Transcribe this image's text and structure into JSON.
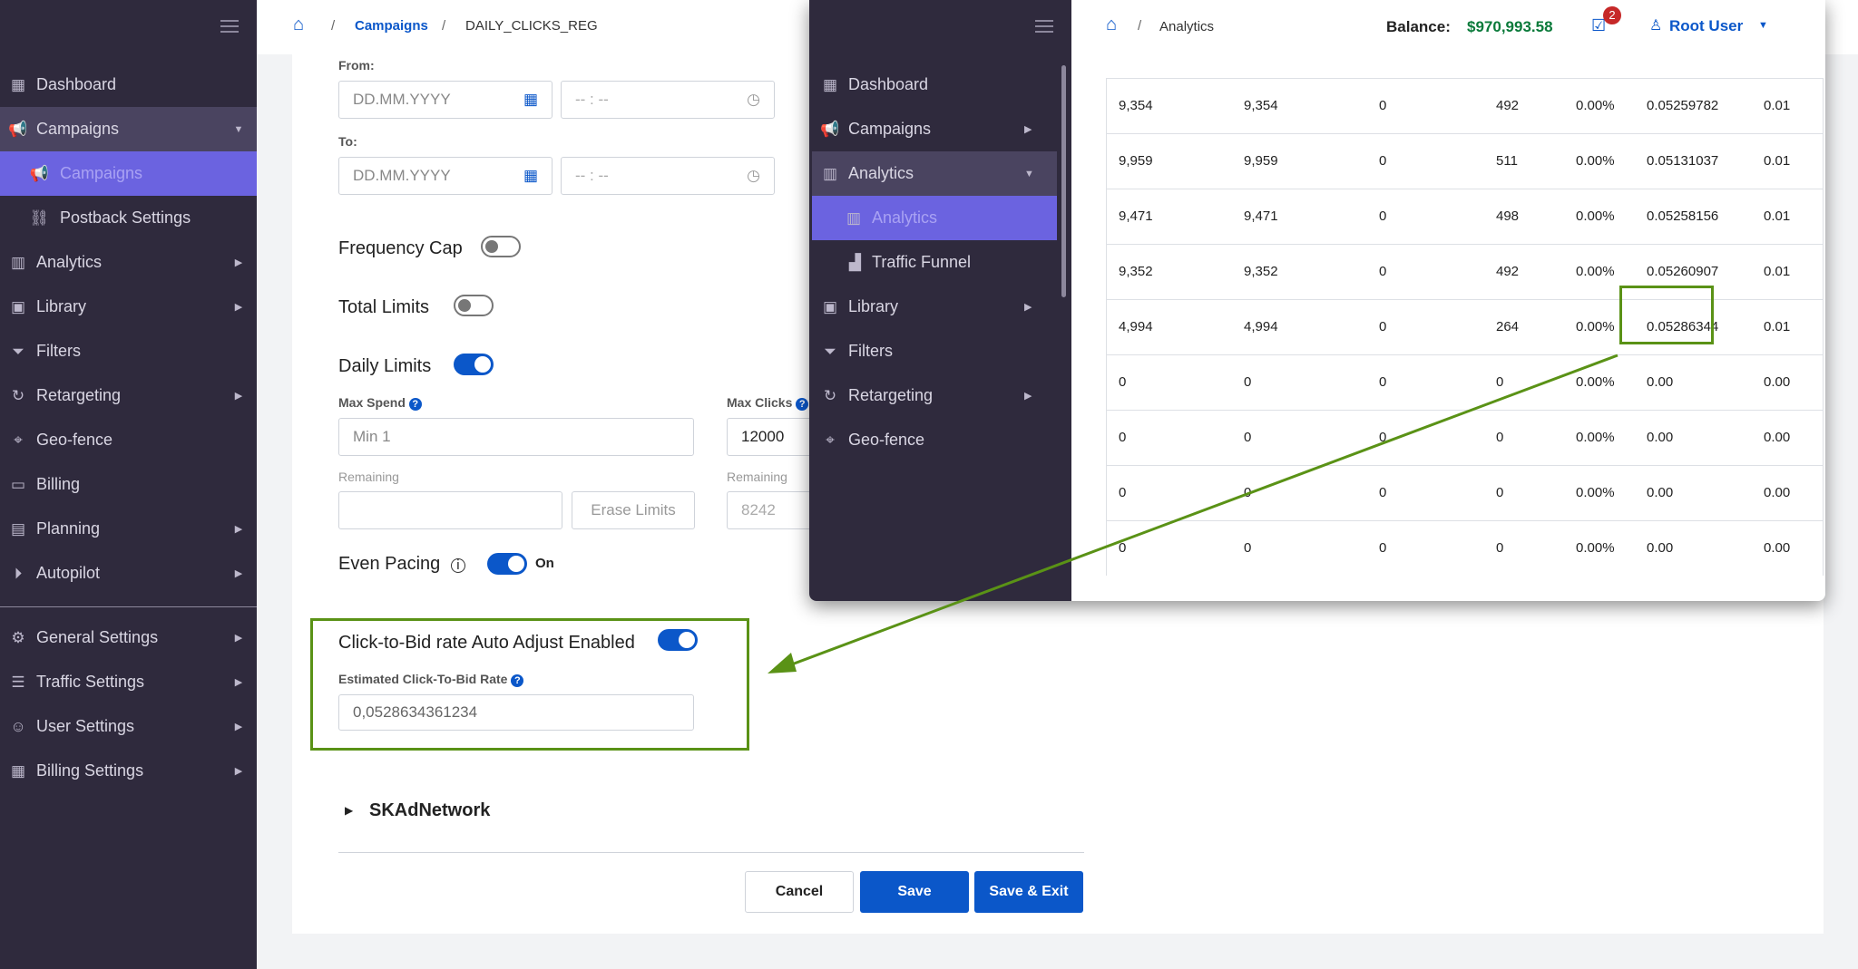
{
  "sidebar": {
    "items": [
      {
        "icon": "dashboard-icon",
        "label": "Dashboard"
      },
      {
        "icon": "megaphone-icon",
        "label": "Campaigns"
      },
      {
        "icon": "megaphone-icon",
        "label": "Campaigns"
      },
      {
        "icon": "link-icon",
        "label": "Postback Settings"
      },
      {
        "icon": "chart-icon",
        "label": "Analytics"
      },
      {
        "icon": "library-icon",
        "label": "Library"
      },
      {
        "icon": "filter-icon",
        "label": "Filters"
      },
      {
        "icon": "retarget-icon",
        "label": "Retargeting"
      },
      {
        "icon": "pin-icon",
        "label": "Geo-fence"
      },
      {
        "icon": "card-icon",
        "label": "Billing"
      },
      {
        "icon": "calendar-icon",
        "label": "Planning"
      },
      {
        "icon": "play-icon",
        "label": "Autopilot"
      },
      {
        "icon": "gear-icon",
        "label": "General Settings"
      },
      {
        "icon": "traffic-icon",
        "label": "Traffic Settings"
      },
      {
        "icon": "user-icon",
        "label": "User Settings"
      },
      {
        "icon": "billing-icon",
        "label": "Billing Settings"
      }
    ]
  },
  "breadcrumb": {
    "link": "Campaigns",
    "current": "DAILY_CLICKS_REG",
    "sep": "/"
  },
  "form": {
    "from_label": "From:",
    "to_label": "To:",
    "date_placeholder": "DD.MM.YYYY",
    "time_placeholder": "-- : --",
    "frequency_cap": "Frequency Cap",
    "total_limits": "Total Limits",
    "daily_limits": "Daily Limits",
    "max_spend_label": "Max Spend",
    "max_spend_placeholder": "Min 1",
    "max_clicks_label": "Max Clicks",
    "max_clicks_value": "12000",
    "remaining_label": "Remaining",
    "remaining_spend": "",
    "erase_limits": "Erase Limits",
    "remaining_clicks": "8242",
    "even_pacing": "Even Pacing",
    "even_pacing_state": "On",
    "ctb_label": "Click-to-Bid rate Auto Adjust Enabled",
    "ctb_est_label": "Estimated Click-To-Bid Rate",
    "ctb_est_value": "0,0528634361234",
    "skadnetwork": "SKAdNetwork",
    "cancel": "Cancel",
    "save": "Save",
    "save_exit": "Save & Exit"
  },
  "overlay": {
    "breadcrumb": "Analytics",
    "balance_label": "Balance:",
    "balance_value": "$970,993.58",
    "tasks_badge": "2",
    "user": "Root User",
    "nav": [
      {
        "icon": "dashboard-icon",
        "label": "Dashboard"
      },
      {
        "icon": "megaphone-icon",
        "label": "Campaigns"
      },
      {
        "icon": "chart-icon",
        "label": "Analytics"
      },
      {
        "icon": "chart-icon",
        "label": "Analytics"
      },
      {
        "icon": "funnel-icon",
        "label": "Traffic Funnel"
      },
      {
        "icon": "library-icon",
        "label": "Library"
      },
      {
        "icon": "filter-icon",
        "label": "Filters"
      },
      {
        "icon": "retarget-icon",
        "label": "Retargeting"
      },
      {
        "icon": "pin-icon",
        "label": "Geo-fence"
      }
    ],
    "rows": [
      [
        "9,354",
        "9,354",
        "0",
        "492",
        "0.00%",
        "0.05259782",
        "0.01"
      ],
      [
        "9,959",
        "9,959",
        "0",
        "511",
        "0.00%",
        "0.05131037",
        "0.01"
      ],
      [
        "9,471",
        "9,471",
        "0",
        "498",
        "0.00%",
        "0.05258156",
        "0.01"
      ],
      [
        "9,352",
        "9,352",
        "0",
        "492",
        "0.00%",
        "0.05260907",
        "0.01"
      ],
      [
        "4,994",
        "4,994",
        "0",
        "264",
        "0.00%",
        "0.05286344",
        "0.01"
      ],
      [
        "0",
        "0",
        "0",
        "0",
        "0.00%",
        "0.00",
        "0.00"
      ],
      [
        "0",
        "0",
        "0",
        "0",
        "0.00%",
        "0.00",
        "0.00"
      ],
      [
        "0",
        "0",
        "0",
        "0",
        "0.00%",
        "0.00",
        "0.00"
      ],
      [
        "0",
        "0",
        "0",
        "0",
        "0.00%",
        "0.00",
        "0.00"
      ]
    ]
  },
  "colors": {
    "accent": "#0b57c9",
    "sidebar": "#2f2a3d",
    "active": "#6b63e0",
    "highlight": "#5a9216",
    "balance": "#0a7a3a"
  }
}
